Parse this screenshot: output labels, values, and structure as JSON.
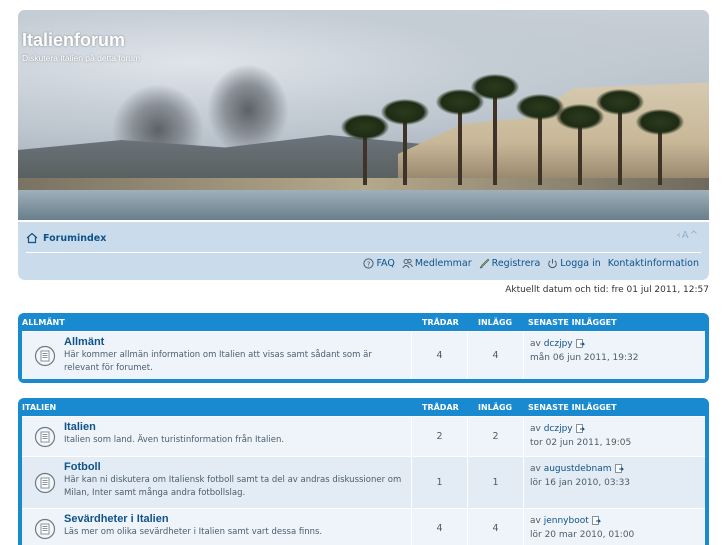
{
  "header": {
    "site_title": "Italienforum",
    "site_description": "Diskutera Italien på detta forum"
  },
  "nav": {
    "breadcrumb": "Forumindex",
    "font_size_control": "‹A^",
    "links": [
      {
        "label": "FAQ",
        "icon": "help-icon"
      },
      {
        "label": "Medlemmar",
        "icon": "members-icon"
      },
      {
        "label": "Registrera",
        "icon": "register-icon"
      },
      {
        "label": "Logga in",
        "icon": "power-icon"
      },
      {
        "label": "Kontaktinformation",
        "icon": ""
      }
    ]
  },
  "datetime": "Aktuellt datum och tid: fre 01 jul 2011, 12:57",
  "columns": {
    "threads": "TRÅDAR",
    "posts": "INLÄGG",
    "last_post": "SENASTE INLÄGGET"
  },
  "categories": [
    {
      "name": "ALLMÄNT",
      "forums": [
        {
          "title": "Allmänt",
          "description": "Här kommer allmän information om Italien att visas samt sådant som är relevant för forumet.",
          "threads": "4",
          "posts": "4",
          "last_by_prefix": "av ",
          "last_author": "dczjpy",
          "last_date": "mån 06 jun 2011, 19:32"
        }
      ]
    },
    {
      "name": "ITALIEN",
      "forums": [
        {
          "title": "Italien",
          "description": "Italien som land. Även turistinformation från Italien.",
          "threads": "2",
          "posts": "2",
          "last_by_prefix": "av ",
          "last_author": "dczjpy",
          "last_date": "tor 02 jun 2011, 19:05"
        },
        {
          "title": "Fotboll",
          "description": "Här kan ni diskutera om Italiensk fotboll samt ta del av andras diskussioner om Milan, Inter samt många andra fotbollslag.",
          "threads": "1",
          "posts": "1",
          "last_by_prefix": "av ",
          "last_author": "augustdebnam",
          "last_date": "lör 16 jan 2010, 03:33"
        },
        {
          "title": "Sevärdheter i Italien",
          "description": "Läs mer om olika sevärdheter i Italien samt vart dessa finns.",
          "threads": "4",
          "posts": "4",
          "last_by_prefix": "av ",
          "last_author": "jennyboot",
          "last_date": "lör 20 mar 2010, 01:00"
        }
      ]
    }
  ]
}
